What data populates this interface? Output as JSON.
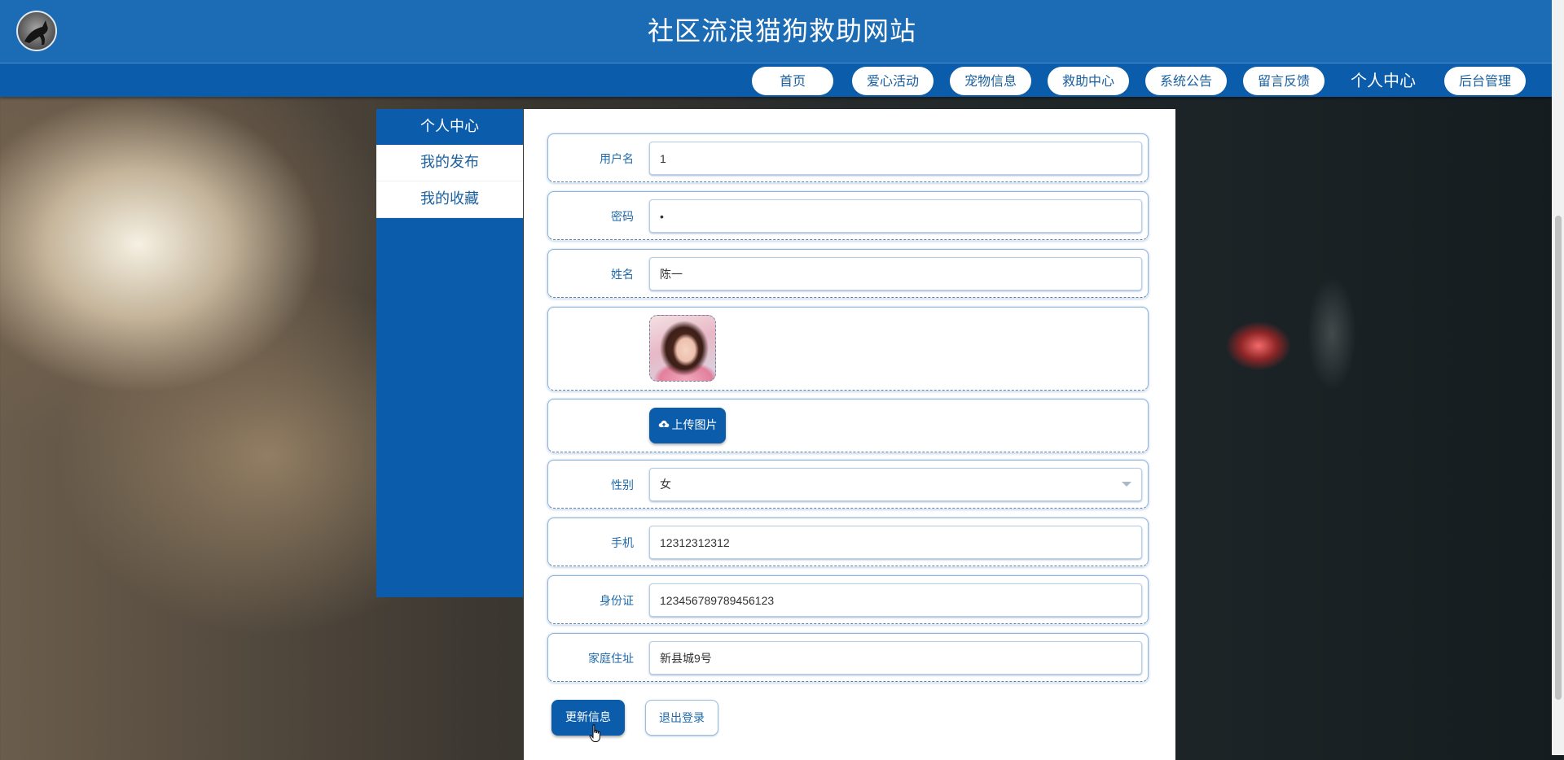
{
  "header": {
    "site_title": "社区流浪猫狗救助网站"
  },
  "nav": {
    "items": [
      {
        "label": "首页"
      },
      {
        "label": "爱心活动"
      },
      {
        "label": "宠物信息"
      },
      {
        "label": "救助中心"
      },
      {
        "label": "系统公告"
      },
      {
        "label": "留言反馈"
      },
      {
        "label": "个人中心",
        "active": true
      },
      {
        "label": "后台管理"
      }
    ]
  },
  "sidebar": {
    "items": [
      {
        "label": "个人中心",
        "active": true
      },
      {
        "label": "我的发布"
      },
      {
        "label": "我的收藏"
      }
    ]
  },
  "form": {
    "username": {
      "label": "用户名",
      "value": "1"
    },
    "password": {
      "label": "密码",
      "value": "•"
    },
    "name": {
      "label": "姓名",
      "value": "陈一"
    },
    "upload_label": "上传图片",
    "gender": {
      "label": "性别",
      "value": "女"
    },
    "phone": {
      "label": "手机",
      "value": "12312312312"
    },
    "id_card": {
      "label": "身份证",
      "value": "123456789789456123"
    },
    "address": {
      "label": "家庭住址",
      "value": "新县城9号"
    }
  },
  "actions": {
    "update_label": "更新信息",
    "logout_label": "退出登录"
  },
  "colors": {
    "header_bg": "#1c6cb5",
    "nav_bg": "#0b5cab",
    "accent": "#0b5cab",
    "label_text": "#1f6aab"
  }
}
